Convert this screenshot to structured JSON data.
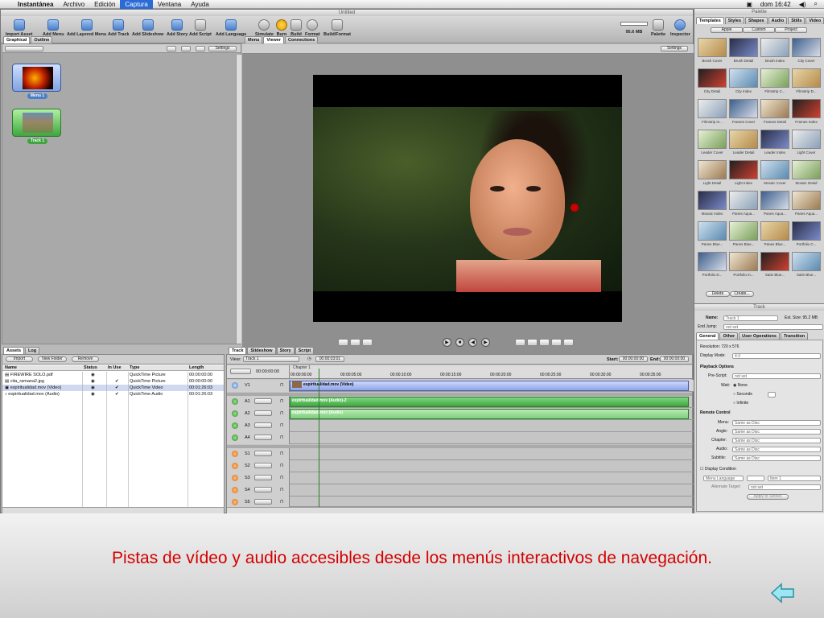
{
  "menubar": {
    "app": "Instantánea",
    "items": [
      "Archivo",
      "Edición",
      "Captura",
      "Ventana",
      "Ayuda"
    ],
    "active": "Captura",
    "clock": "dom 16:42"
  },
  "window": {
    "title": "Untitled",
    "toolbar": {
      "left": [
        "Import Asset",
        "Add Menu",
        "Add Layered Menu",
        "Add Track",
        "Add Slideshow",
        "Add Story",
        "Add Script",
        "Add Language"
      ],
      "middle": [
        "Simulate",
        "Burn",
        "Build",
        "Format",
        "Build/Format"
      ],
      "size": "95.6 MB",
      "right": [
        "Palette",
        "Inspector"
      ]
    }
  },
  "graph_panel": {
    "tabs": [
      "Graphical",
      "Outline"
    ],
    "settings": "Settings",
    "nodes": [
      "Menu 1",
      "Track 1"
    ]
  },
  "viewer_panel": {
    "tabs": [
      "Menu",
      "Viewer",
      "Connections"
    ],
    "settings": "Settings"
  },
  "assets": {
    "tabs": [
      "Assets",
      "Log"
    ],
    "buttons": [
      "Import",
      "New Folder",
      "Remove"
    ],
    "columns": [
      "Name",
      "Status",
      "In Use",
      "Type",
      "Length"
    ],
    "rows": [
      {
        "name": "FIREWIRE SOLO.pdf",
        "in_use": "",
        "type": "QuickTime Picture",
        "length": "00:00:00:00"
      },
      {
        "name": "cita_ramana2.jpg",
        "in_use": "✔",
        "type": "QuickTime Picture",
        "length": "00:00:00:00"
      },
      {
        "name": "espiritualidad.mov (Video)",
        "in_use": "✔",
        "type": "QuickTime Video",
        "length": "00:01:26:03"
      },
      {
        "name": "espiritualidad.mov (Audio)",
        "in_use": "✔",
        "type": "QuickTime Audio",
        "length": "00:01:26:03"
      }
    ]
  },
  "timeline": {
    "tabs": [
      "Track",
      "Slideshow",
      "Story",
      "Script"
    ],
    "view_label": "View:",
    "view_value": "Track 1",
    "timecode": "00:00:03:01",
    "start_label": "Start:",
    "start": "00:00:00:00",
    "end_label": "End:",
    "end": "00:00:00:00",
    "current": "00:00:00:00",
    "chapter": "Chapter 1",
    "ruler": [
      "00:00:00:00",
      "00:00:05:00",
      "00:00:10:00",
      "00:00:15:00",
      "00:00:20:00",
      "00:00:25:00",
      "00:00:30:00",
      "00:00:35:00"
    ],
    "tracks": [
      {
        "id": "V1",
        "clip": "espiritualidad.mov (Video)",
        "kind": "video"
      },
      {
        "id": "A1",
        "clip": "espiritualidad.mov (Audio)-2",
        "kind": "audio"
      },
      {
        "id": "A2",
        "clip": "espiritualidad.mov (Audio)",
        "kind": "audio"
      },
      {
        "id": "A3",
        "clip": "",
        "kind": "audio"
      },
      {
        "id": "A4",
        "clip": "",
        "kind": "audio"
      },
      {
        "id": "S1",
        "clip": "",
        "kind": "sub"
      },
      {
        "id": "S2",
        "clip": "",
        "kind": "sub"
      },
      {
        "id": "S3",
        "clip": "",
        "kind": "sub"
      },
      {
        "id": "S4",
        "clip": "",
        "kind": "sub"
      },
      {
        "id": "S5",
        "clip": "",
        "kind": "sub"
      }
    ]
  },
  "palette": {
    "title": "Palette",
    "tabs": [
      "Templates",
      "Styles",
      "Shapes",
      "Audio",
      "Stills",
      "Video"
    ],
    "subtabs": [
      "Apple",
      "Custom",
      "Project"
    ],
    "templates": [
      "Brush Cover",
      "Brush Detail",
      "Brush Index",
      "City Cover",
      "City Detail",
      "City Index",
      "Filmstrip C...",
      "Filmstrip D...",
      "Filmstrip In...",
      "Frames Cover",
      "Frames Detail",
      "Frames Index",
      "Leader Cover",
      "Leader Detail",
      "Leader Index",
      "Light Cover",
      "Light Detail",
      "Light Index",
      "Mosaic Cover",
      "Mosaic Detail",
      "Mosaic Index",
      "Panes Aqua...",
      "Panes Aqua...",
      "Panes Aqua...",
      "Panes Blue...",
      "Panes Blue...",
      "Panes Blue...",
      "Portfolio C...",
      "Portfolio D...",
      "Portfolio In...",
      "Satin Blue...",
      "Satin Blue..."
    ],
    "buttons": [
      "Delete",
      "Create..."
    ]
  },
  "inspector": {
    "title": "Track",
    "name_label": "Name:",
    "name": "Track 1",
    "est_size": "Est. Size: 95.2 MB",
    "end_jump_label": "End Jump:",
    "end_jump": "not set",
    "tabs": [
      "General",
      "Other",
      "User Operations",
      "Transition"
    ],
    "resolution": "Resolution: 720 x 576",
    "display_mode_label": "Display Mode:",
    "display_mode": "4:3",
    "playback_header": "Playback Options",
    "prescript_label": "Pre-Script:",
    "prescript": "not set",
    "wait_label": "Wait:",
    "wait_options": [
      "None",
      "Seconds",
      "Infinite"
    ],
    "remote_header": "Remote Control",
    "remote": [
      {
        "label": "Menu:",
        "value": "Same as Disc"
      },
      {
        "label": "Angle:",
        "value": "Same as Disc"
      },
      {
        "label": "Chapter:",
        "value": "Same as Disc"
      },
      {
        "label": "Audio:",
        "value": "Same as Disc"
      },
      {
        "label": "Subtitle:",
        "value": "Same as Disc"
      }
    ],
    "display_condition": "Display Condition",
    "menu_language": "Menu Language",
    "menu_language_value": "Item 1",
    "alternate_target_label": "Alternate Target:",
    "alternate_target": "not set",
    "apply_button": "Apply to Stories"
  },
  "caption": "Pistas de vídeo y audio accesibles desde los menús interactivos de navegación.",
  "back_icon": "back-arrow-icon",
  "colors": {
    "caption": "#d40000",
    "accent": "#2b6bd6",
    "clip_green": "#3fa63f"
  }
}
